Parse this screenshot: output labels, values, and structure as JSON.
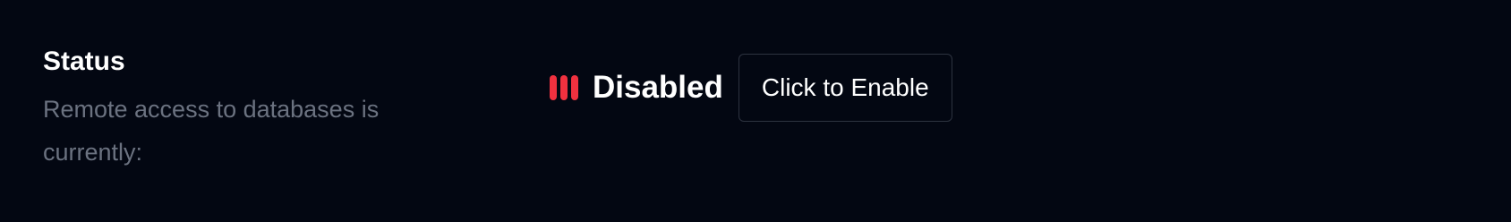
{
  "status_section": {
    "heading": "Status",
    "description": "Remote access to databases is currently:",
    "status_value": "Disabled",
    "status_icon": "status-bars-icon",
    "status_color": "#f0313f",
    "enable_button_label": "Click to Enable"
  },
  "colors": {
    "background": "#030712",
    "heading": "#ffffff",
    "description": "#6b7280",
    "button_border": "#2d3340"
  }
}
